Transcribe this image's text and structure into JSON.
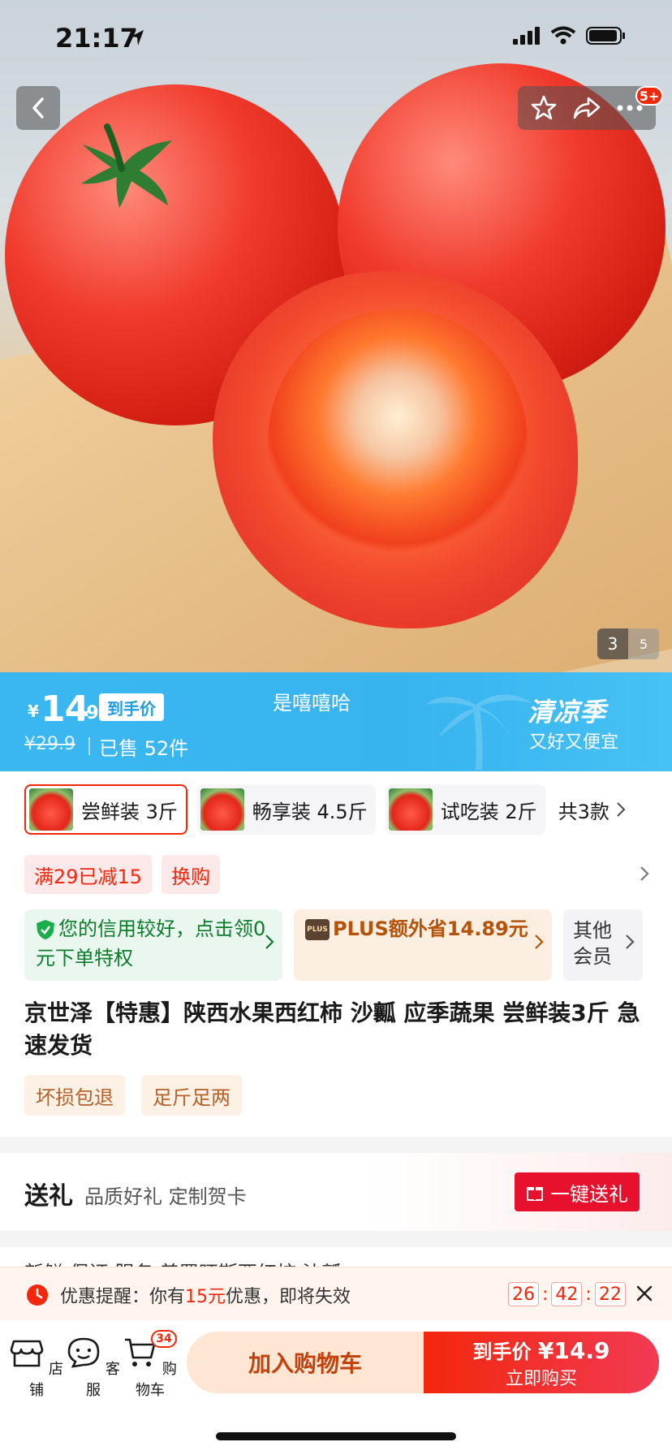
{
  "status_bar": {
    "time": "21:17"
  },
  "hero": {
    "page_current": "3",
    "page_total": "5",
    "notif_badge": "5+"
  },
  "price_banner": {
    "currency": "¥",
    "price_int": "14",
    "price_dec": ".9",
    "price_tag": "到手价",
    "original_price": "¥29.9",
    "sold": "已售 52件",
    "shop_slogan": "是嘻嘻哈",
    "season_title": "清凉季",
    "season_sub": "又好又便宜"
  },
  "variants": {
    "items": [
      {
        "label": "尝鲜装 3斤",
        "selected": true
      },
      {
        "label": "畅享装 4.5斤",
        "selected": false
      },
      {
        "label": "试吃装 2斤",
        "selected": false
      }
    ],
    "more": "共3款"
  },
  "promos": [
    "满29已减15",
    "换购"
  ],
  "perks": {
    "credit": "您的信用较好，点击领0元下单特权",
    "plus_logo": "PLUS",
    "plus": "PLUS额外省14.89元",
    "member": "其他会员"
  },
  "product_title": "京世泽【特惠】陕西水果西红柿 沙瓤 应季蔬果 尝鲜装3斤 急速发货",
  "tags": [
    "坏损包退",
    "足斤足两"
  ],
  "gift": {
    "title": "送礼",
    "sub": "品质好礼 定制贺卡",
    "button": "一键送礼"
  },
  "peek_row": "新鲜 保证 服务          普罗旺斯西红柿          沙瓤",
  "coupon": {
    "prefix": "优惠提醒：你有",
    "amount": "15元",
    "suffix": "优惠，即将失效",
    "timer": [
      "26",
      "42",
      "22"
    ]
  },
  "bottom_bar": {
    "shop": "店铺",
    "service": "客服",
    "cart": "购物车",
    "cart_count": "34",
    "add_cart": "加入购物车",
    "buy_line1_prefix": "到手价 ",
    "buy_price": "¥14.9",
    "buy_line2": "立即购买"
  },
  "colors": {
    "accent": "#f2270c",
    "banner_blue": "#37b3ee"
  }
}
